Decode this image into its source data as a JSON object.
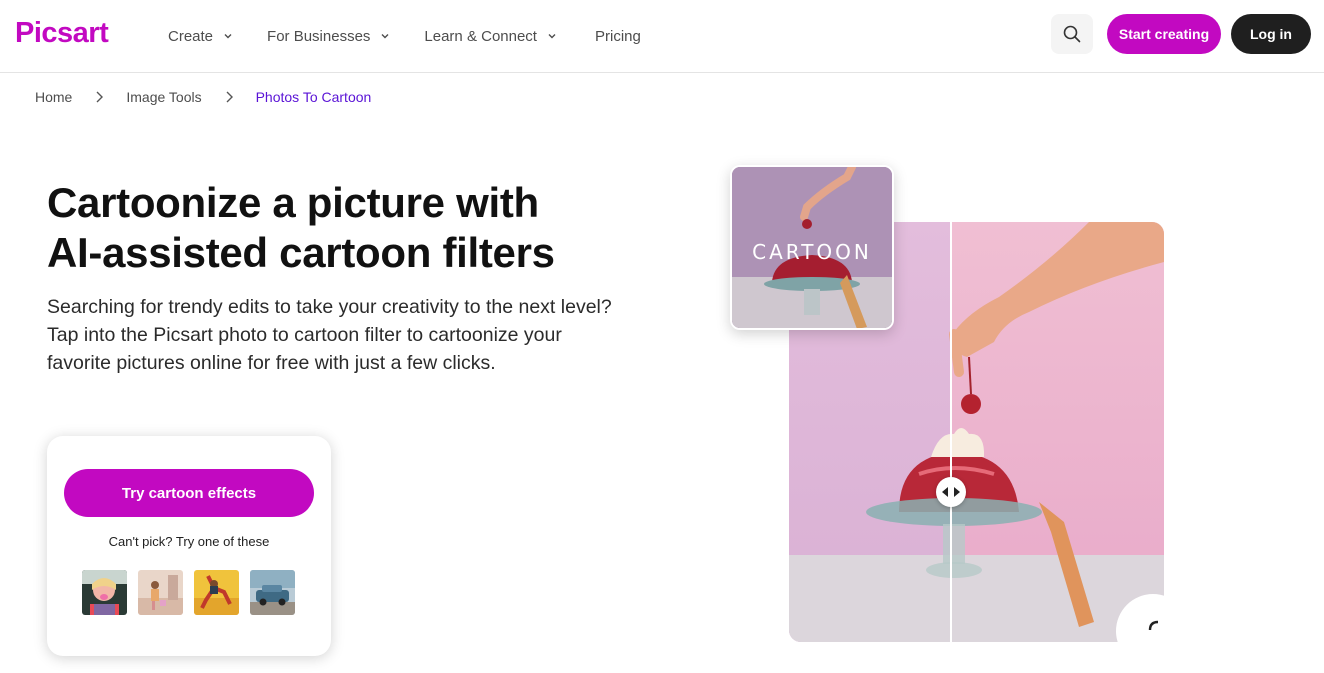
{
  "header": {
    "logo": "Picsart",
    "nav": [
      {
        "label": "Create"
      },
      {
        "label": "For Businesses"
      },
      {
        "label": "Learn & Connect"
      }
    ],
    "pricing": "Pricing",
    "start_creating": "Start creating",
    "login": "Log in"
  },
  "breadcrumb": {
    "home": "Home",
    "image_tools": "Image Tools",
    "current": "Photos To Cartoon"
  },
  "hero": {
    "title_line1": "Cartoonize a picture with",
    "title_line2": "AI-assisted cartoon filters",
    "description": "Searching for trendy edits to take your creativity to the next level? Tap into the Picsart photo to cartoon filter to cartoonize your favorite pictures online for free with just a few clicks."
  },
  "cta": {
    "button": "Try cartoon effects",
    "subtitle": "Can't pick? Try one of these"
  },
  "visual": {
    "inset_label": "CARTOON"
  },
  "colors": {
    "brand": "#c209c1",
    "breadcrumb_active": "#5a13d6",
    "dark_button": "#1f1f1f"
  }
}
